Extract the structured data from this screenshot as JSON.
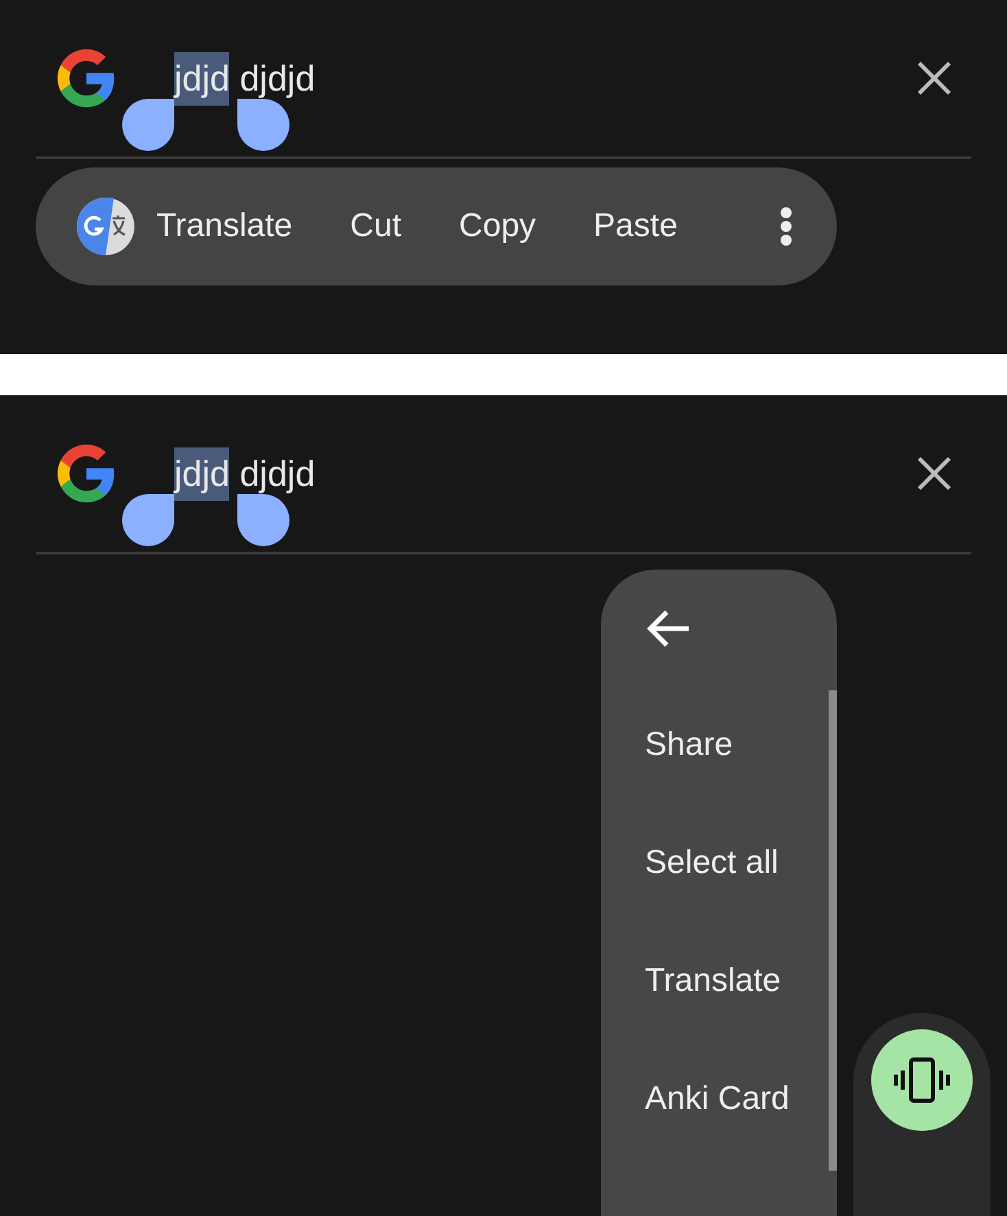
{
  "screens": [
    {
      "kind": "toolbar",
      "search": {
        "selected_text": "jdjd",
        "rest_text": "djdjd"
      },
      "toolbar": {
        "items": [
          {
            "kind": "translate",
            "label": "Translate"
          },
          {
            "kind": "text",
            "label": "Cut"
          },
          {
            "kind": "text",
            "label": "Copy"
          },
          {
            "kind": "text",
            "label": "Paste"
          },
          {
            "kind": "more"
          }
        ]
      }
    },
    {
      "kind": "menu",
      "search": {
        "selected_text": "jdjd",
        "rest_text": "djdjd"
      },
      "menu": {
        "items": [
          "Share",
          "Select all",
          "Translate",
          "Anki Card"
        ]
      }
    }
  ]
}
